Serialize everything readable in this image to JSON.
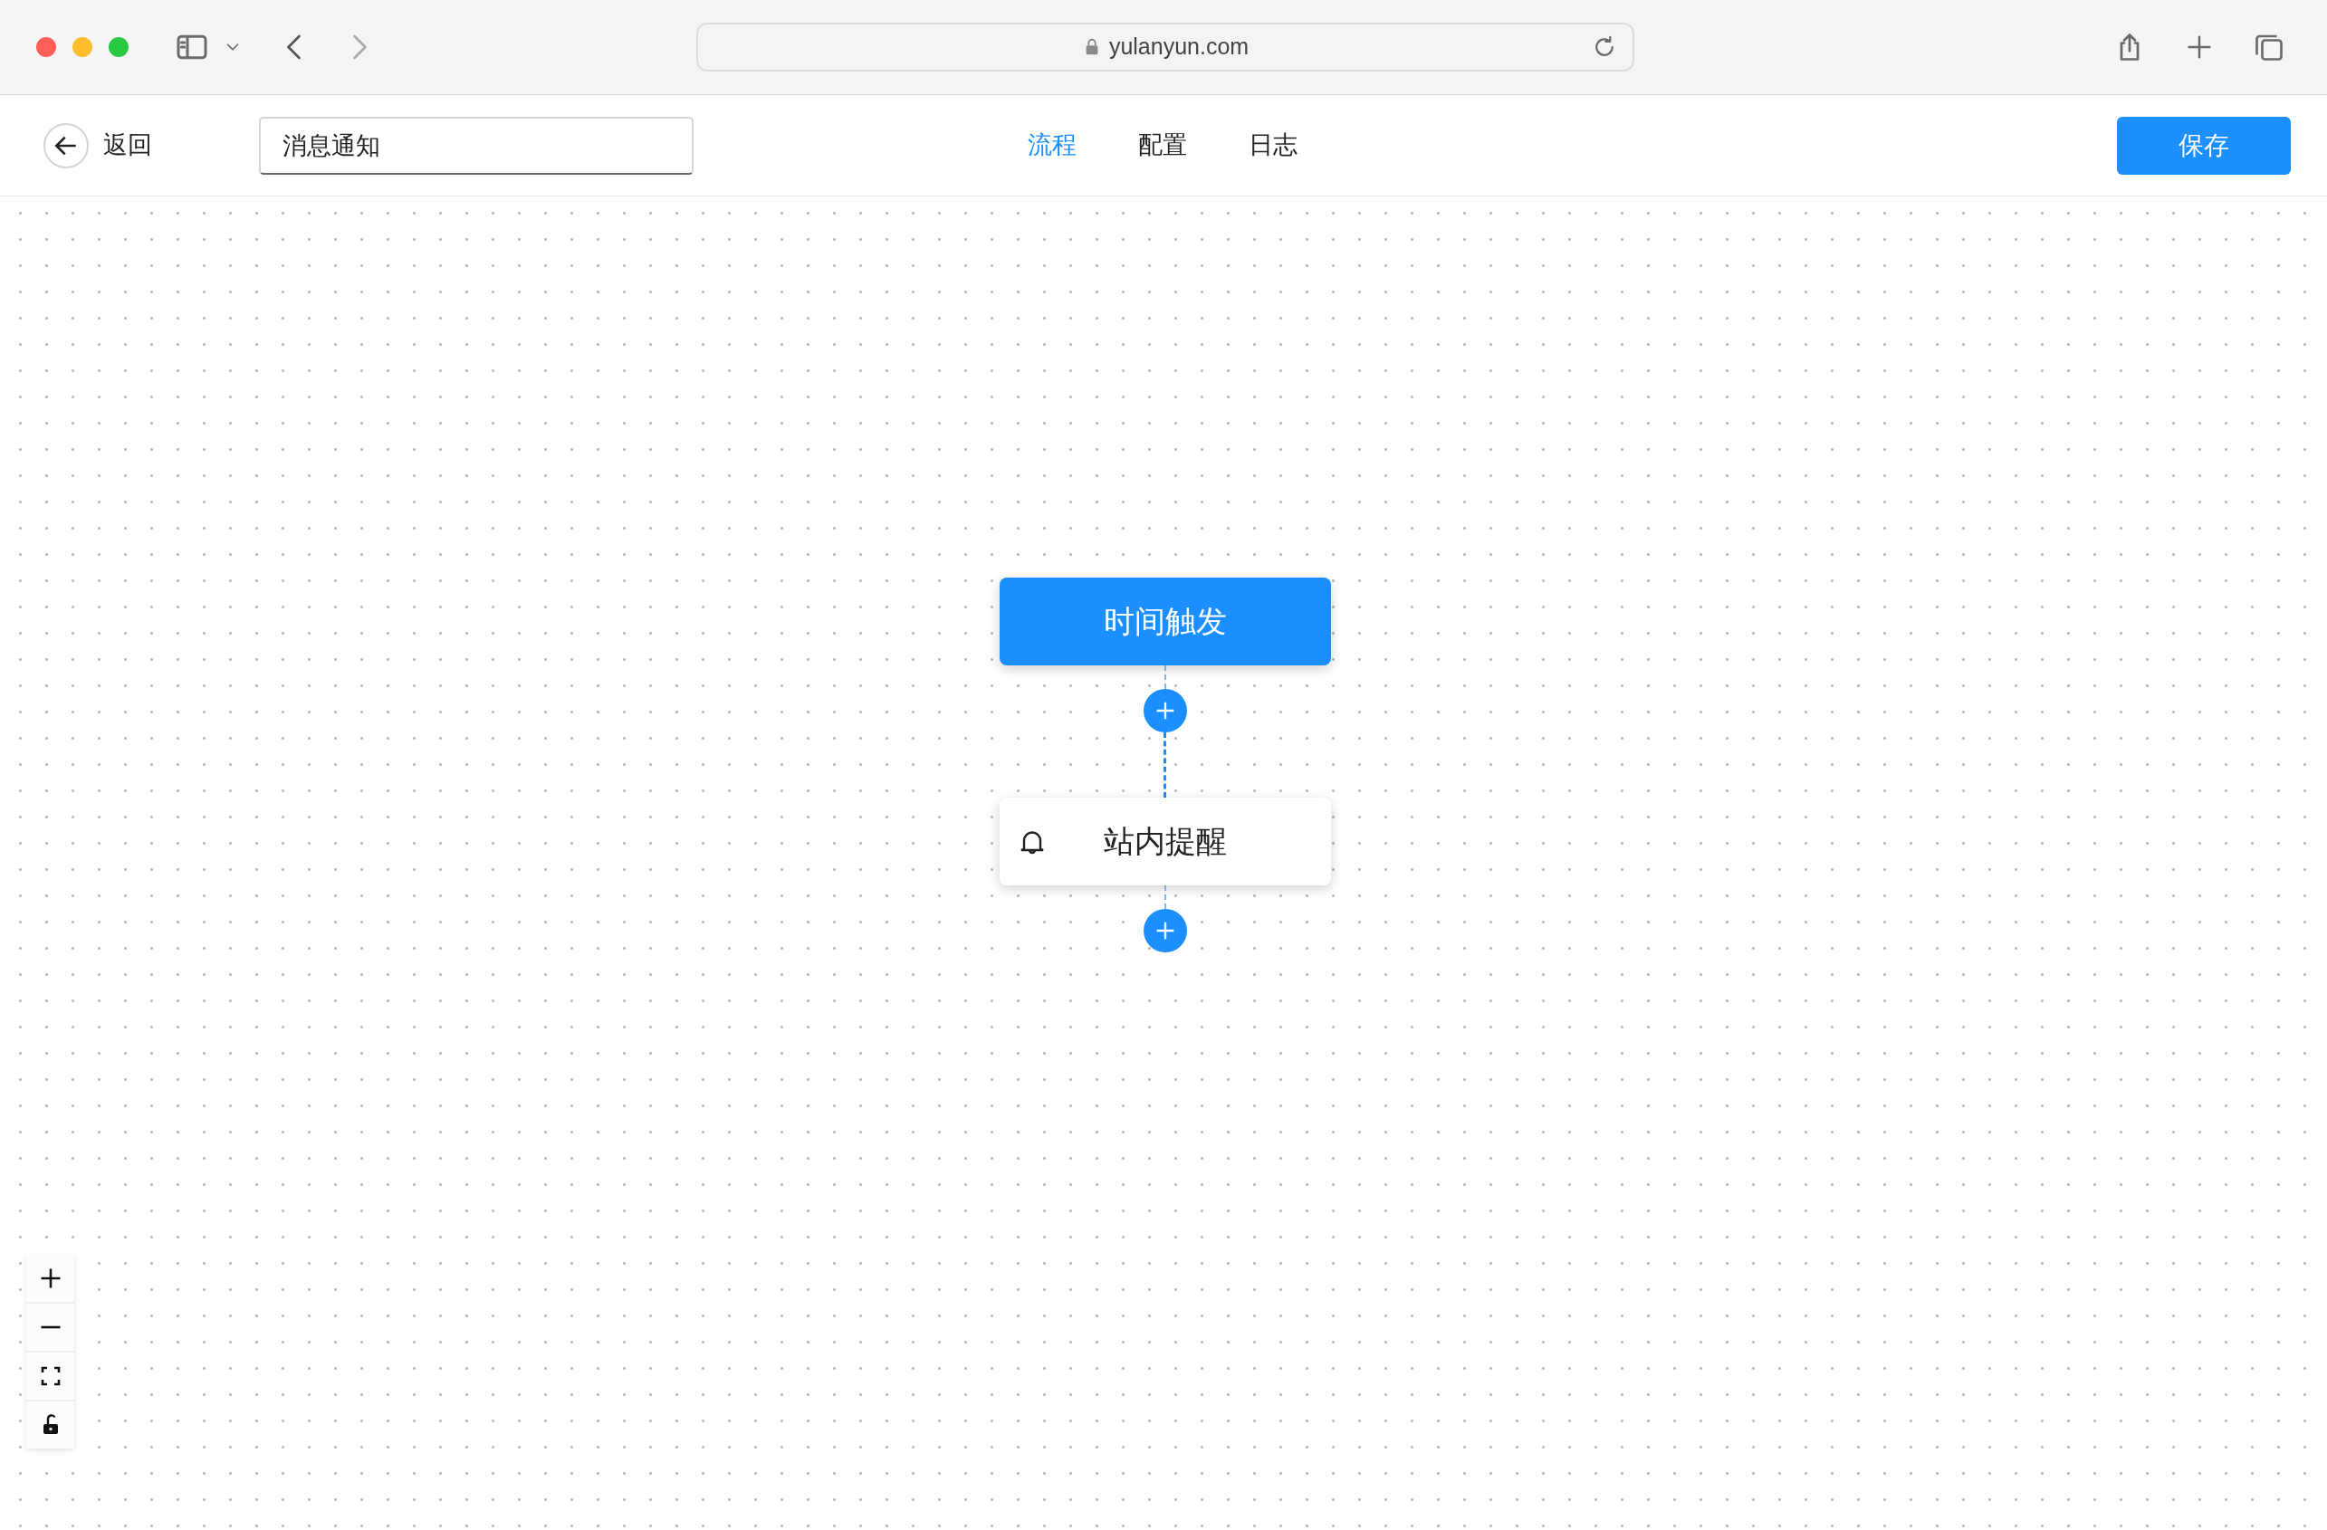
{
  "browser": {
    "url": "yulanyun.com"
  },
  "header": {
    "back_label": "返回",
    "name_value": "消息通知",
    "tabs": [
      {
        "label": "流程",
        "selected": true
      },
      {
        "label": "配置",
        "selected": false
      },
      {
        "label": "日志",
        "selected": false
      }
    ],
    "save_label": "保存"
  },
  "flow": {
    "nodes": [
      {
        "kind": "trigger",
        "label": "时间触发"
      },
      {
        "kind": "action",
        "label": "站内提醒"
      }
    ]
  },
  "canvas_controls": {
    "locked": false
  }
}
